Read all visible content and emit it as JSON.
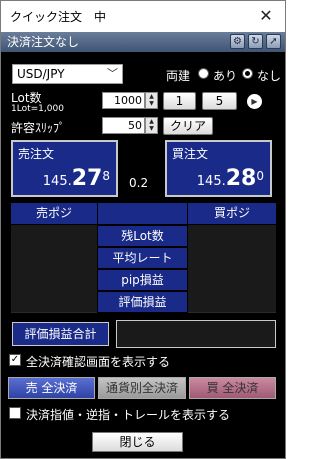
{
  "window": {
    "title": "クイック注文　中",
    "close_icon": "✕"
  },
  "header": {
    "title": "決済注文なし",
    "icons": [
      "gear-icon",
      "refresh-icon",
      "pin-icon"
    ]
  },
  "currency": {
    "selected": "USD/JPY"
  },
  "hedge": {
    "label": "両建",
    "opt_yes": "あり",
    "opt_no": "なし",
    "selected": "なし"
  },
  "lot": {
    "label": "Lot数",
    "sublabel": "1Lot=1,000",
    "value": "1000",
    "btn1": "1",
    "btn5": "5"
  },
  "slippage": {
    "label": "許容ｽﾘｯﾌﾟ",
    "value": "50",
    "clear_label": "クリア"
  },
  "sell": {
    "label": "売注文",
    "p1": "145.",
    "p2": "27",
    "p3": "8"
  },
  "buy": {
    "label": "買注文",
    "p1": "145.",
    "p2": "28",
    "p3": "0"
  },
  "spread": "0.2",
  "positions": {
    "sell_header": "売ポジ",
    "buy_header": "買ポジ",
    "rows": [
      "残Lot数",
      "平均レート",
      "pip損益",
      "評価損益"
    ]
  },
  "total": {
    "label": "評価損益合計"
  },
  "confirm": {
    "label": "全決済確認画面を表示する",
    "checked": true
  },
  "actions": {
    "sell_all": "売 全決済",
    "currency_all": "通貨別全決済",
    "buy_all": "買 全決済"
  },
  "trail": {
    "label": "決済指値・逆指・トレールを表示する",
    "checked": false
  },
  "close_button": "閉じる",
  "colors": {
    "panel_bg": "#000000",
    "accent_blue": "#1a2a88",
    "header_bg": "#3f5576"
  }
}
